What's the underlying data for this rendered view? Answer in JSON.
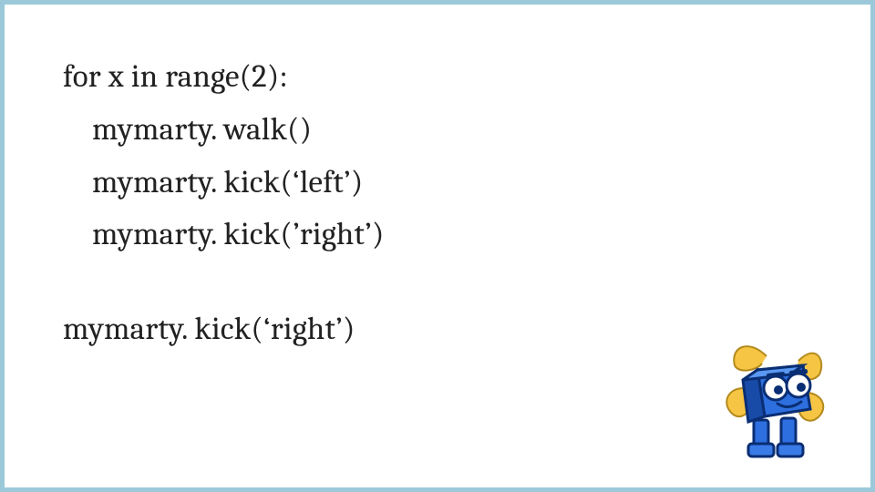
{
  "code": {
    "l1": "for x in range(2):",
    "l2": "mymarty. walk()",
    "l3": "mymarty. kick(‘left’)",
    "l4": "mymarty. kick(’right’)",
    "l5": "mymarty. kick(‘right’)"
  },
  "mascot": {
    "name": "marty-robot"
  }
}
